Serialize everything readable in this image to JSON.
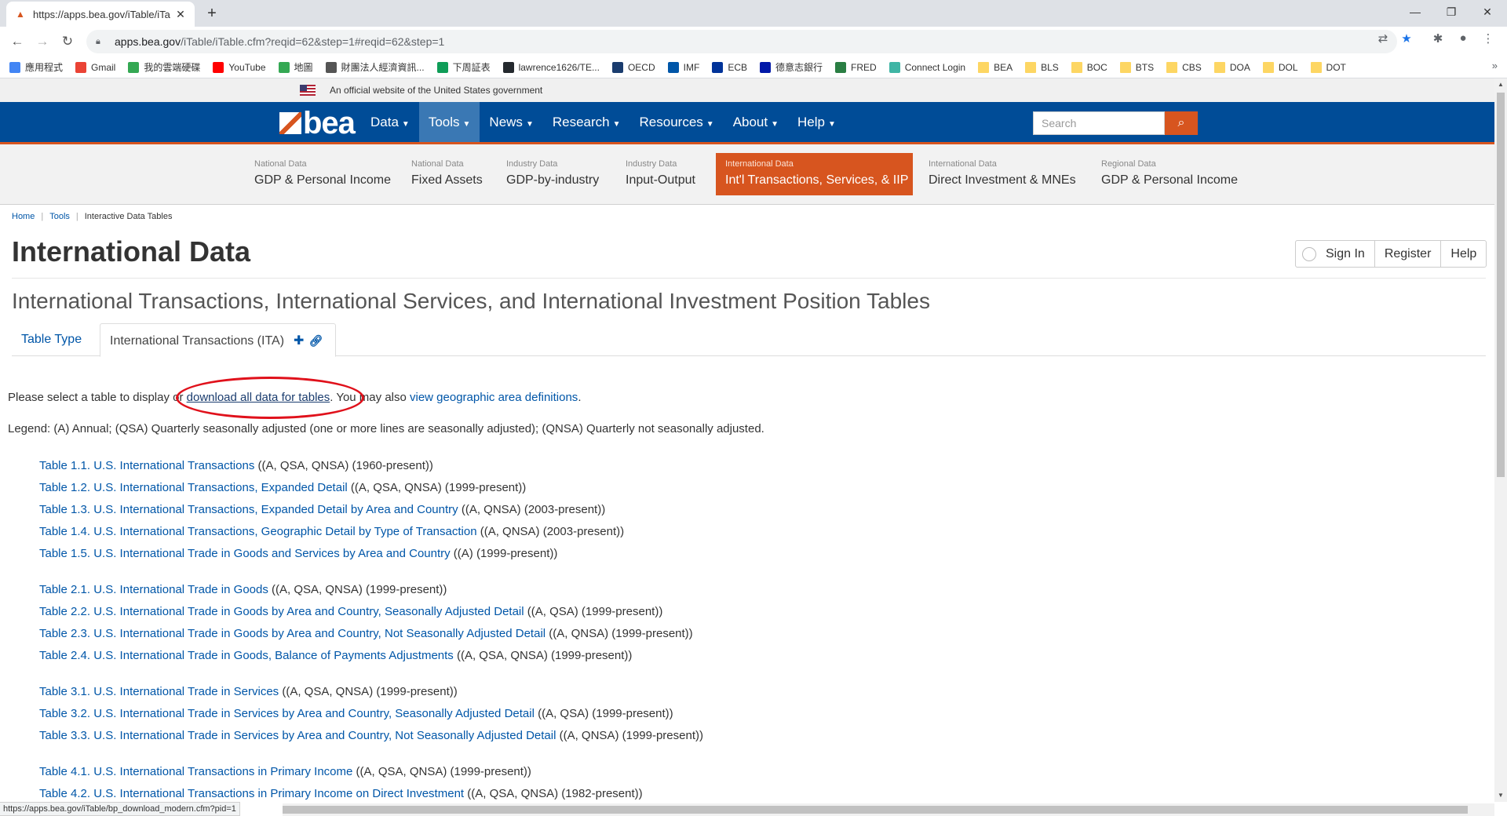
{
  "browser": {
    "tab_title": "https://apps.bea.gov/iTable/iTa",
    "url_host": "apps.bea.gov",
    "url_path": "/iTable/iTable.cfm?reqid=62&step=1#reqid=62&step=1",
    "bookmarks": [
      "應用程式",
      "Gmail",
      "我的雲端硬碟",
      "YouTube",
      "地圖",
      "財團法人經濟資訊...",
      "下周証表",
      "lawrence1626/TE...",
      "OECD",
      "IMF",
      "ECB",
      "德意志銀行",
      "FRED",
      "Connect Login",
      "BEA",
      "BLS",
      "BOC",
      "BTS",
      "CBS",
      "DOA",
      "DOL",
      "DOT"
    ],
    "status_url": "https://apps.bea.gov/iTable/bp_download_modern.cfm?pid=1"
  },
  "site": {
    "gov_banner": "An official website of the United States government",
    "logo_text": "bea",
    "nav": [
      "Data",
      "Tools",
      "News",
      "Research",
      "Resources",
      "About",
      "Help"
    ],
    "search_placeholder": "Search",
    "subnav": [
      {
        "small": "National Data",
        "big": "GDP & Personal Income"
      },
      {
        "small": "National Data",
        "big": "Fixed Assets"
      },
      {
        "small": "Industry Data",
        "big": "GDP-by-industry"
      },
      {
        "small": "Industry Data",
        "big": "Input-Output"
      },
      {
        "small": "International Data",
        "big": "Int'l Transactions, Services, & IIP"
      },
      {
        "small": "International Data",
        "big": "Direct Investment & MNEs"
      },
      {
        "small": "Regional Data",
        "big": "GDP & Personal Income"
      }
    ]
  },
  "breadcrumb": [
    "Home",
    "Tools",
    "Interactive Data Tables"
  ],
  "page_title": "International Data",
  "user_buttons": {
    "sign_in": "Sign In",
    "register": "Register",
    "help": "Help"
  },
  "subtitle": "International Transactions, International Services, and International Investment Position Tables",
  "tabs": {
    "table_type": "Table Type",
    "current": "International Transactions (ITA)"
  },
  "intro": {
    "lead": "Please select a table to display or ",
    "download_link": "download all data for tables",
    "mid": ". You may also ",
    "geo_link": "view geographic area definitions",
    "end": "."
  },
  "legend": "Legend: (A) Annual; (QSA) Quarterly seasonally adjusted (one or more lines are seasonally adjusted); (QNSA) Quarterly not seasonally adjusted.",
  "table_groups": [
    [
      {
        "title": "Table 1.1. U.S. International Transactions",
        "meta": " ((A, QSA, QNSA) (1960-present))"
      },
      {
        "title": "Table 1.2. U.S. International Transactions, Expanded Detail",
        "meta": " ((A, QSA, QNSA) (1999-present))"
      },
      {
        "title": "Table 1.3. U.S. International Transactions, Expanded Detail by Area and Country",
        "meta": " ((A, QNSA) (2003-present))"
      },
      {
        "title": "Table 1.4. U.S. International Transactions, Geographic Detail by Type of Transaction",
        "meta": " ((A, QNSA) (2003-present))"
      },
      {
        "title": "Table 1.5. U.S. International Trade in Goods and Services by Area and Country",
        "meta": " ((A) (1999-present))"
      }
    ],
    [
      {
        "title": "Table 2.1. U.S. International Trade in Goods",
        "meta": " ((A, QSA, QNSA) (1999-present))"
      },
      {
        "title": "Table 2.2. U.S. International Trade in Goods by Area and Country, Seasonally Adjusted Detail",
        "meta": " ((A, QSA) (1999-present))"
      },
      {
        "title": "Table 2.3. U.S. International Trade in Goods by Area and Country, Not Seasonally Adjusted Detail",
        "meta": " ((A, QNSA) (1999-present))"
      },
      {
        "title": "Table 2.4. U.S. International Trade in Goods, Balance of Payments Adjustments",
        "meta": " ((A, QSA, QNSA) (1999-present))"
      }
    ],
    [
      {
        "title": "Table 3.1. U.S. International Trade in Services",
        "meta": " ((A, QSA, QNSA) (1999-present))"
      },
      {
        "title": "Table 3.2. U.S. International Trade in Services by Area and Country, Seasonally Adjusted Detail",
        "meta": " ((A, QSA) (1999-present))"
      },
      {
        "title": "Table 3.3. U.S. International Trade in Services by Area and Country, Not Seasonally Adjusted Detail",
        "meta": " ((A, QNSA) (1999-present))"
      }
    ],
    [
      {
        "title": "Table 4.1. U.S. International Transactions in Primary Income",
        "meta": " ((A, QSA, QNSA) (1999-present))"
      },
      {
        "title": "Table 4.2. U.S. International Transactions in Primary Income on Direct Investment",
        "meta": " ((A, QSA, QNSA) (1982-present))"
      }
    ]
  ],
  "colors": {
    "brand_blue": "#004c97",
    "accent_orange": "#d7551f",
    "link": "#0056a8",
    "annotation": "#e0111b"
  }
}
